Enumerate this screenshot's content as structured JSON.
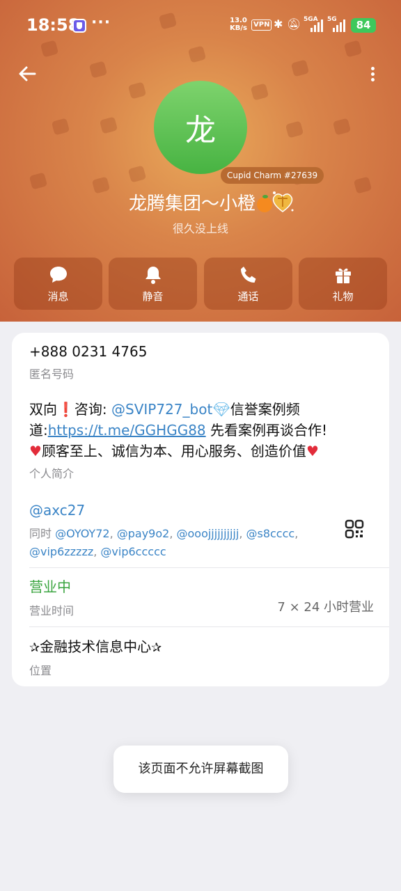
{
  "status_bar": {
    "time": "18:58",
    "net_speed_value": "13.0",
    "net_speed_unit": "KB/s",
    "vpn": "VPN",
    "signal1_label": "5GA",
    "signal2_label": "5G",
    "battery": "84"
  },
  "profile": {
    "avatar_letter": "龙",
    "cupid_badge": "Cupid Charm #27639",
    "name": "龙腾集团～小橙",
    "last_seen": "很久没上线"
  },
  "actions": [
    {
      "label": "消息",
      "icon": "message-icon"
    },
    {
      "label": "静音",
      "icon": "bell-icon"
    },
    {
      "label": "通话",
      "icon": "phone-icon"
    },
    {
      "label": "礼物",
      "icon": "gift-icon"
    }
  ],
  "info": {
    "phone": "+888 0231 4765",
    "phone_label": "匿名号码",
    "bio": {
      "prefix": "双向",
      "ask": "咨询: ",
      "bot": "@SVIP727_bot",
      "mid1": "信誉案例频",
      "mid2": "道:",
      "url": "https://t.me/GGHGG88",
      "after_url": " 先看案例再谈合作!",
      "line3": "顾客至上、诚信为本、用心服务、创造价值"
    },
    "bio_label": "个人简介",
    "username": "@axc27",
    "also_prefix": "同时 ",
    "also_usernames": [
      "@OYOY72",
      "@pay9o2",
      "@ooojjjjjjjjjj",
      "@s8cccc",
      "@vip6zzzzz",
      "@vip6ccccc"
    ],
    "hours_status": "营业中",
    "hours_label": "营业时间",
    "hours_value": "7 × 24 小时营业",
    "location": "金融技术信息中心",
    "location_label": "位置"
  },
  "toast": "该页面不允许屏幕截图",
  "colors": {
    "header_center": "#e9a95a",
    "header_edge": "#c7623a",
    "avatar_green": "#47b342",
    "link_blue": "#3a84c6",
    "open_green": "#3aa43f",
    "background": "#efeff3"
  }
}
